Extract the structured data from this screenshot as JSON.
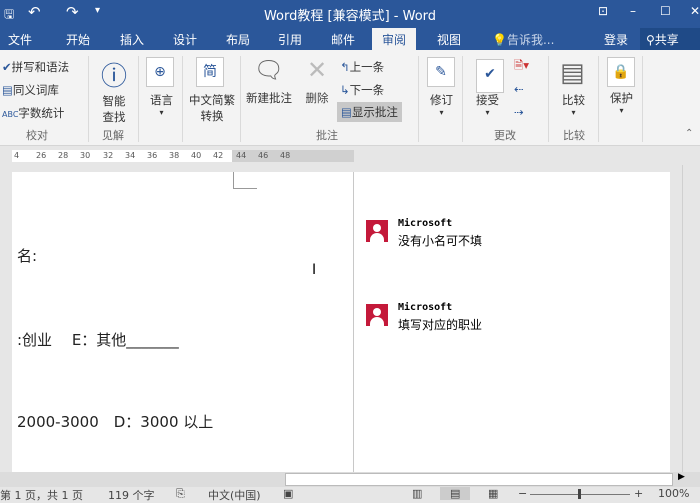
{
  "title": "Word教程 [兼容模式] - Word",
  "tabs": [
    "文件",
    "开始",
    "插入",
    "设计",
    "布局",
    "引用",
    "邮件",
    "审阅",
    "视图"
  ],
  "tell_me": "告诉我...",
  "signin": "登录",
  "share": "共享",
  "ribbon": {
    "proofing": {
      "items": [
        "拼写和语法",
        "同义词库",
        "字数统计"
      ],
      "label": "校对"
    },
    "insights": {
      "button": "智能\n查找",
      "l1": "智能",
      "l2": "查找",
      "label": "见解"
    },
    "language": "语言",
    "convert": {
      "l1": "中文简繁",
      "l2": "转换"
    },
    "comments": {
      "new": "新建批注",
      "delete": "删除",
      "prev": "上一条",
      "next": "下一条",
      "show": "显示批注",
      "label": "批注"
    },
    "track": "修订",
    "changes": {
      "accept": "接受",
      "label": "更改"
    },
    "compare": {
      "button": "比较",
      "label": "比较"
    },
    "protect": "保护"
  },
  "ruler": [
    "4",
    "26",
    "28",
    "30",
    "32",
    "34",
    "36",
    "38",
    "40",
    "42",
    "44",
    "46",
    "48"
  ],
  "document": {
    "lines": [
      "名:",
      ":创业　 E：其他_______",
      "2000-3000　D：3000 以上"
    ]
  },
  "comments": [
    {
      "author": "Microsoft",
      "text": "没有小名可不填"
    },
    {
      "author": "Microsoft",
      "text": "填写对应的职业"
    }
  ],
  "status": {
    "page": "第 1 页，共 1 页",
    "words": "119 个字",
    "language": "中文(中国)",
    "zoom": "100%"
  }
}
